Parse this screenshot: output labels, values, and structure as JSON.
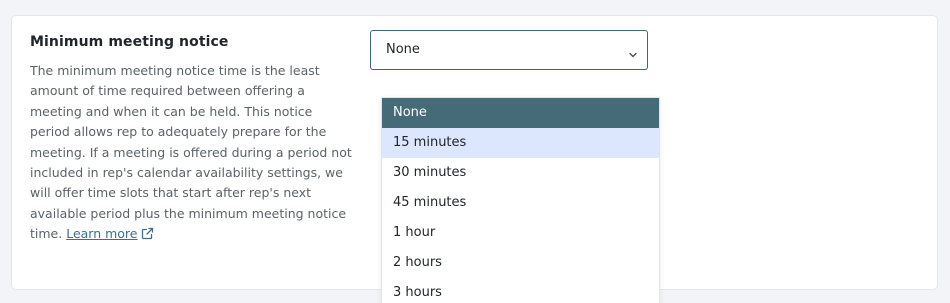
{
  "setting": {
    "title": "Minimum meeting notice",
    "description": "The minimum meeting notice time is the least amount of time required between offering a meeting and when it can be held. This notice period allows rep to adequately prepare for the meeting. If a meeting is offered during a period not included in rep's calendar availability settings, we will offer time slots that start after rep's next available period plus the minimum meeting notice time.",
    "learn_more": "Learn more",
    "learn_more_icon": "external-link-icon"
  },
  "select": {
    "value": "None",
    "icon": "chevron-down-icon"
  },
  "dropdown": {
    "options": [
      {
        "label": "None",
        "state": "selected"
      },
      {
        "label": "15 minutes",
        "state": "hover"
      },
      {
        "label": "30 minutes",
        "state": "normal"
      },
      {
        "label": "45 minutes",
        "state": "normal"
      },
      {
        "label": "1 hour",
        "state": "normal"
      },
      {
        "label": "2 hours",
        "state": "normal"
      },
      {
        "label": "3 hours",
        "state": "normal"
      }
    ]
  },
  "colors": {
    "accent": "#466b78",
    "hover": "#dce6fc",
    "link": "#3e6f86",
    "border": "#3d6779"
  }
}
